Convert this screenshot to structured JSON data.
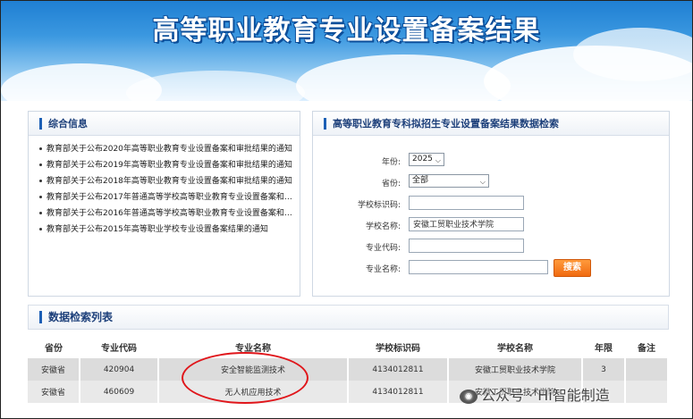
{
  "banner": {
    "title": "高等职业教育专业设置备案结果"
  },
  "overview": {
    "title": "综合信息",
    "items": [
      "教育部关于公布2020年高等职业教育专业设置备案和审批结果的通知",
      "教育部关于公布2019年高等职业教育专业设置备案和审批结果的通知",
      "教育部关于公布2018年高等职业教育专业设置备案和审批结果的通知",
      "教育部关于公布2017年普通高等学校高等职业教育专业设置备案和审…",
      "教育部关于公布2016年普通高等学校高等职业教育专业设置备案和审…",
      "教育部关于公布2015年高等职业学校专业设置备案结果的通知"
    ]
  },
  "search": {
    "title": "高等职业教育专科拟招生专业设置备案结果数据检索",
    "year_label": "年份:",
    "year_value": "2025",
    "province_label": "省份:",
    "province_value": "全部",
    "school_code_label": "学校标识码:",
    "school_code_value": "",
    "school_name_label": "学校名称:",
    "school_name_value": "安徽工贸职业技术学院",
    "major_code_label": "专业代码:",
    "major_code_value": "",
    "major_name_label": "专业名称:",
    "major_name_value": "",
    "search_button": "搜索"
  },
  "results": {
    "title": "数据检索列表",
    "columns": [
      "省份",
      "专业代码",
      "专业名称",
      "学校标识码",
      "学校名称",
      "年限",
      "备注"
    ],
    "rows": [
      [
        "安徽省",
        "420904",
        "安全智能监测技术",
        "4134012811",
        "安徽工贸职业技术学院",
        "3",
        ""
      ],
      [
        "安徽省",
        "460609",
        "无人机应用技术",
        "4134012811",
        "安徽工贸职业技术学院",
        "",
        ""
      ]
    ]
  },
  "watermark": {
    "text": "公众号 · Hi智能制造"
  },
  "colors": {
    "accent": "#1c5fb5",
    "button": "#f06a10",
    "highlight": "#e0161b"
  },
  "icons": {
    "dropdown": "chevron-down-icon",
    "watermark": "wechat-icon"
  }
}
